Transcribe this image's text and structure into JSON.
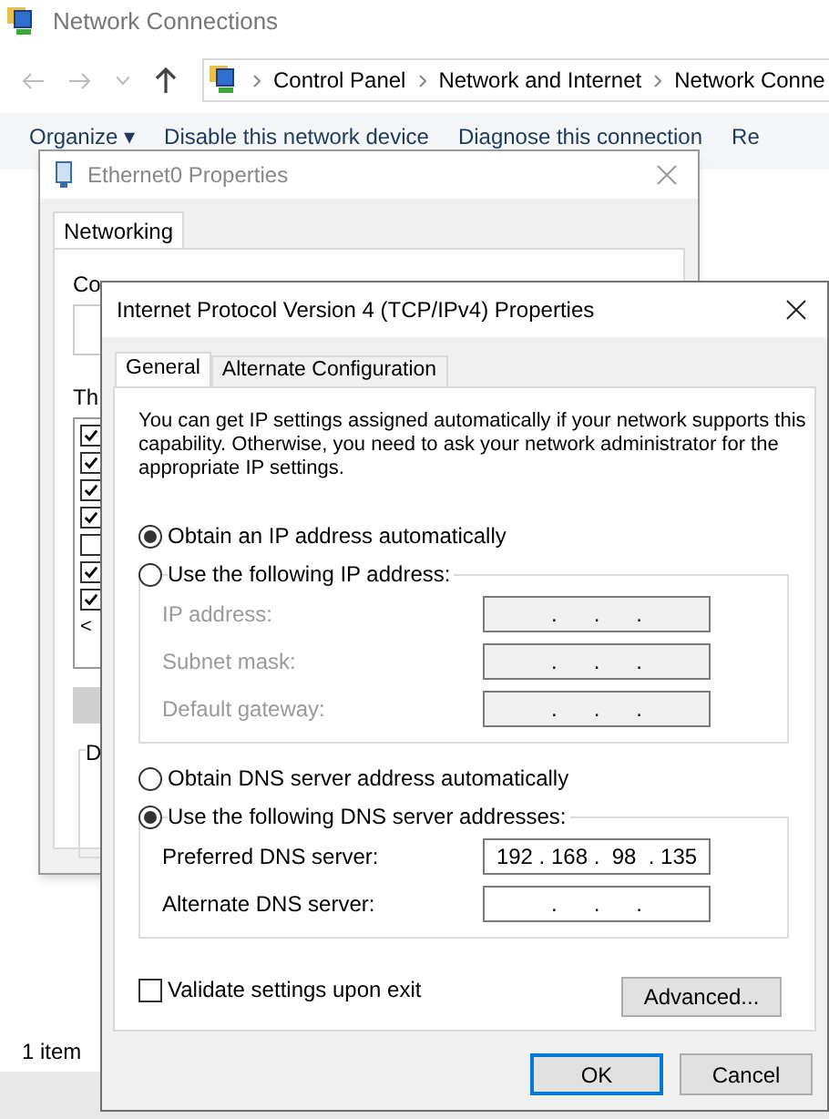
{
  "explorer": {
    "title": "Network Connections",
    "breadcrumb": [
      "Control Panel",
      "Network and Internet",
      "Network Conne"
    ],
    "toolbar": [
      "Organize ▾",
      "Disable this network device",
      "Diagnose this connection",
      "Re"
    ],
    "status": "1 item"
  },
  "ethernet": {
    "title": "Ethernet0 Properties",
    "tabs": [
      {
        "label": "Networking",
        "selected": true
      }
    ],
    "connect_label": "Co",
    "list_label": "Th",
    "items": [
      {
        "checked": true
      },
      {
        "checked": true
      },
      {
        "checked": true
      },
      {
        "checked": true
      },
      {
        "checked": false
      },
      {
        "checked": true
      },
      {
        "checked": true
      }
    ],
    "scroll_arrow": "<",
    "group_label": "D"
  },
  "ipv4": {
    "title": "Internet Protocol Version 4 (TCP/IPv4) Properties",
    "tabs": [
      {
        "label": "General",
        "selected": true
      },
      {
        "label": "Alternate Configuration",
        "selected": false
      }
    ],
    "description": "You can get IP settings assigned automatically if your network supports this capability. Otherwise, you need to ask your network administrator for the appropriate IP settings.",
    "ip_modes": [
      {
        "label": "Obtain an IP address automatically",
        "selected": true
      },
      {
        "label": "Use the following IP address:",
        "selected": false
      }
    ],
    "ip_fields": [
      {
        "label": "IP address:",
        "value": ".      .      .",
        "disabled": true
      },
      {
        "label": "Subnet mask:",
        "value": ".      .      .",
        "disabled": true
      },
      {
        "label": "Default gateway:",
        "value": ".      .      .",
        "disabled": true
      }
    ],
    "dns_modes": [
      {
        "label": "Obtain DNS server address automatically",
        "selected": false
      },
      {
        "label": "Use the following DNS server addresses:",
        "selected": true
      }
    ],
    "dns_fields": [
      {
        "label": "Preferred DNS server:",
        "value": "192 . 168 .  98  . 135",
        "disabled": false
      },
      {
        "label": "Alternate DNS server:",
        "value": ".      .      .",
        "disabled": false
      }
    ],
    "validate": {
      "label": "Validate settings upon exit",
      "checked": false
    },
    "advanced": "Advanced...",
    "ok": "OK",
    "cancel": "Cancel"
  }
}
